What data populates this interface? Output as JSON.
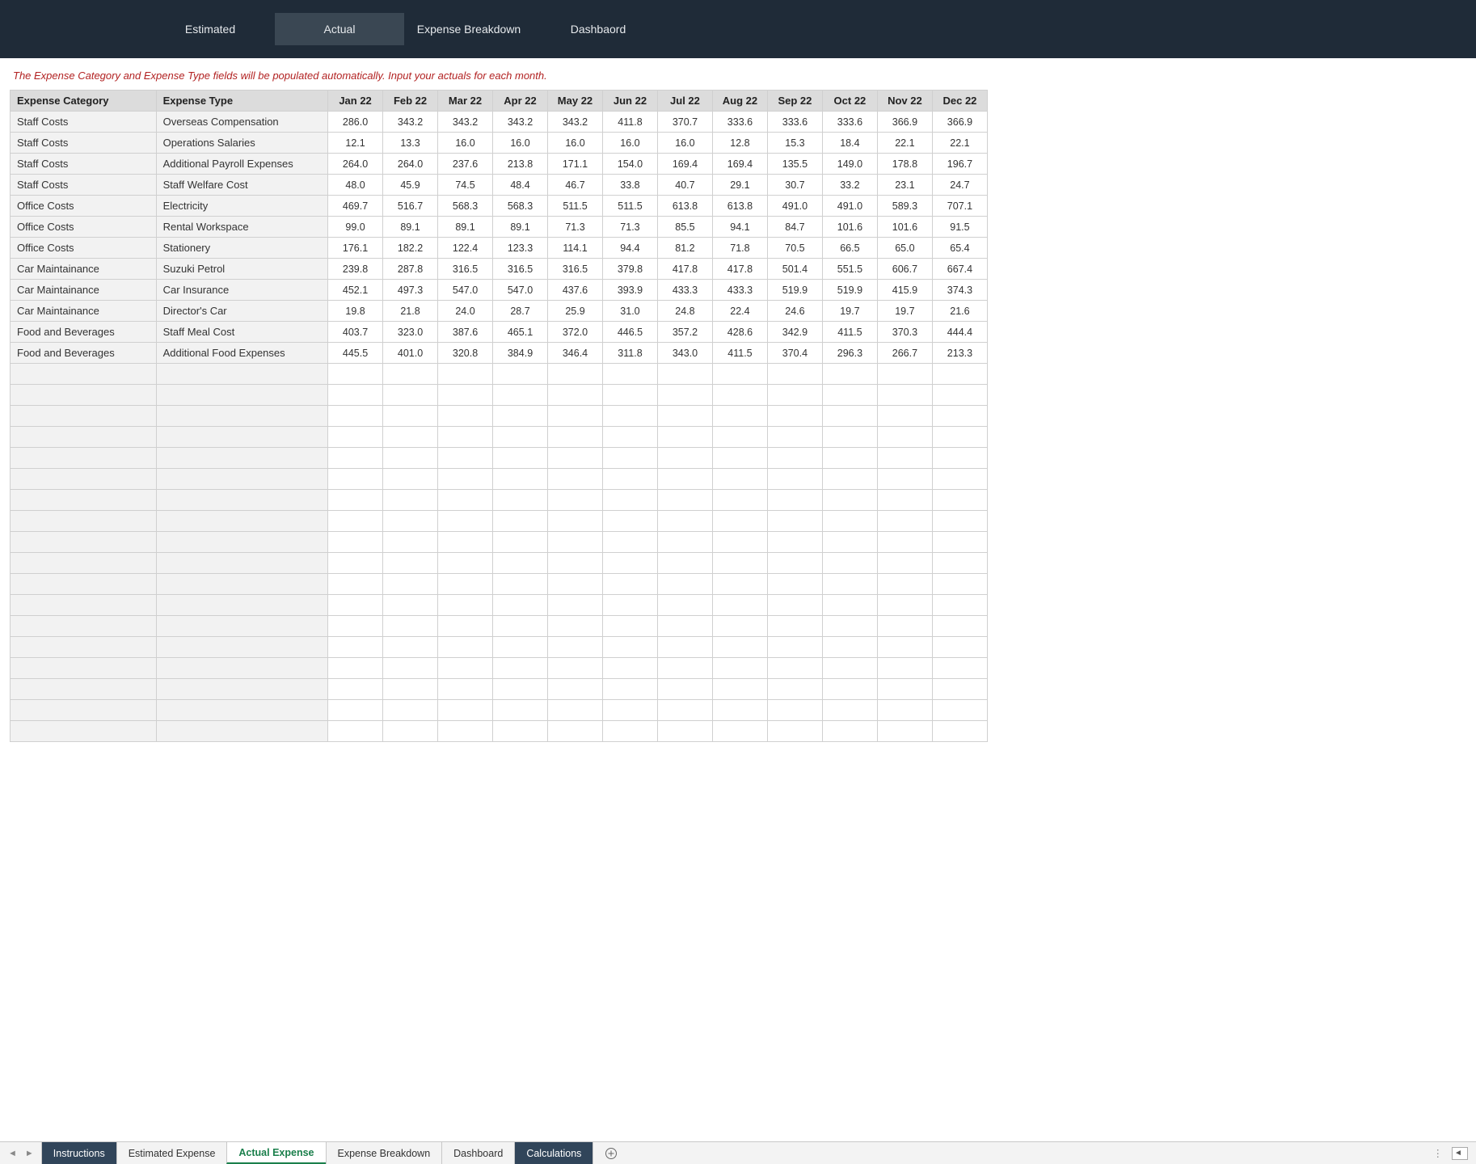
{
  "topnav": {
    "items": [
      {
        "label": "Estimated",
        "active": false
      },
      {
        "label": "Actual",
        "active": true
      },
      {
        "label": "Expense Breakdown",
        "active": false
      },
      {
        "label": "Dashbaord",
        "active": false
      }
    ]
  },
  "instruction": "The Expense Category and Expense Type fields will be populated automatically. Input your actuals for each month.",
  "table": {
    "headers": {
      "category": "Expense Category",
      "type": "Expense Type",
      "months": [
        "Jan 22",
        "Feb 22",
        "Mar 22",
        "Apr 22",
        "May 22",
        "Jun 22",
        "Jul 22",
        "Aug 22",
        "Sep 22",
        "Oct 22",
        "Nov 22",
        "Dec 22"
      ]
    },
    "rows": [
      {
        "category": "Staff Costs",
        "type": "Overseas Compensation",
        "values": [
          "286.0",
          "343.2",
          "343.2",
          "343.2",
          "343.2",
          "411.8",
          "370.7",
          "333.6",
          "333.6",
          "333.6",
          "366.9",
          "366.9"
        ]
      },
      {
        "category": "Staff Costs",
        "type": "Operations Salaries",
        "values": [
          "12.1",
          "13.3",
          "16.0",
          "16.0",
          "16.0",
          "16.0",
          "16.0",
          "12.8",
          "15.3",
          "18.4",
          "22.1",
          "22.1"
        ]
      },
      {
        "category": "Staff Costs",
        "type": "Additional Payroll Expenses",
        "values": [
          "264.0",
          "264.0",
          "237.6",
          "213.8",
          "171.1",
          "154.0",
          "169.4",
          "169.4",
          "135.5",
          "149.0",
          "178.8",
          "196.7"
        ]
      },
      {
        "category": "Staff Costs",
        "type": "Staff Welfare Cost",
        "values": [
          "48.0",
          "45.9",
          "74.5",
          "48.4",
          "46.7",
          "33.8",
          "40.7",
          "29.1",
          "30.7",
          "33.2",
          "23.1",
          "24.7"
        ]
      },
      {
        "category": "Office Costs",
        "type": "Electricity",
        "values": [
          "469.7",
          "516.7",
          "568.3",
          "568.3",
          "511.5",
          "511.5",
          "613.8",
          "613.8",
          "491.0",
          "491.0",
          "589.3",
          "707.1"
        ]
      },
      {
        "category": "Office Costs",
        "type": "Rental Workspace",
        "values": [
          "99.0",
          "89.1",
          "89.1",
          "89.1",
          "71.3",
          "71.3",
          "85.5",
          "94.1",
          "84.7",
          "101.6",
          "101.6",
          "91.5"
        ]
      },
      {
        "category": "Office Costs",
        "type": "Stationery",
        "values": [
          "176.1",
          "182.2",
          "122.4",
          "123.3",
          "114.1",
          "94.4",
          "81.2",
          "71.8",
          "70.5",
          "66.5",
          "65.0",
          "65.4"
        ]
      },
      {
        "category": "Car Maintainance",
        "type": "Suzuki Petrol",
        "values": [
          "239.8",
          "287.8",
          "316.5",
          "316.5",
          "316.5",
          "379.8",
          "417.8",
          "417.8",
          "501.4",
          "551.5",
          "606.7",
          "667.4"
        ]
      },
      {
        "category": "Car Maintainance",
        "type": "Car Insurance",
        "values": [
          "452.1",
          "497.3",
          "547.0",
          "547.0",
          "437.6",
          "393.9",
          "433.3",
          "433.3",
          "519.9",
          "519.9",
          "415.9",
          "374.3"
        ]
      },
      {
        "category": "Car Maintainance",
        "type": "Director's Car",
        "values": [
          "19.8",
          "21.8",
          "24.0",
          "28.7",
          "25.9",
          "31.0",
          "24.8",
          "22.4",
          "24.6",
          "19.7",
          "19.7",
          "21.6"
        ]
      },
      {
        "category": "Food and Beverages",
        "type": "Staff Meal Cost",
        "values": [
          "403.7",
          "323.0",
          "387.6",
          "465.1",
          "372.0",
          "446.5",
          "357.2",
          "428.6",
          "342.9",
          "411.5",
          "370.3",
          "444.4"
        ]
      },
      {
        "category": "Food and Beverages",
        "type": "Additional Food Expenses",
        "values": [
          "445.5",
          "401.0",
          "320.8",
          "384.9",
          "346.4",
          "311.8",
          "343.0",
          "411.5",
          "370.4",
          "296.3",
          "266.7",
          "213.3"
        ]
      }
    ],
    "empty_rows": 18
  },
  "sheetbar": {
    "tabs": [
      {
        "label": "Instructions",
        "style": "dark"
      },
      {
        "label": "Estimated Expense",
        "style": "normal"
      },
      {
        "label": "Actual Expense",
        "style": "active"
      },
      {
        "label": "Expense Breakdown",
        "style": "normal"
      },
      {
        "label": "Dashboard",
        "style": "normal"
      },
      {
        "label": "Calculations",
        "style": "dark"
      }
    ]
  }
}
